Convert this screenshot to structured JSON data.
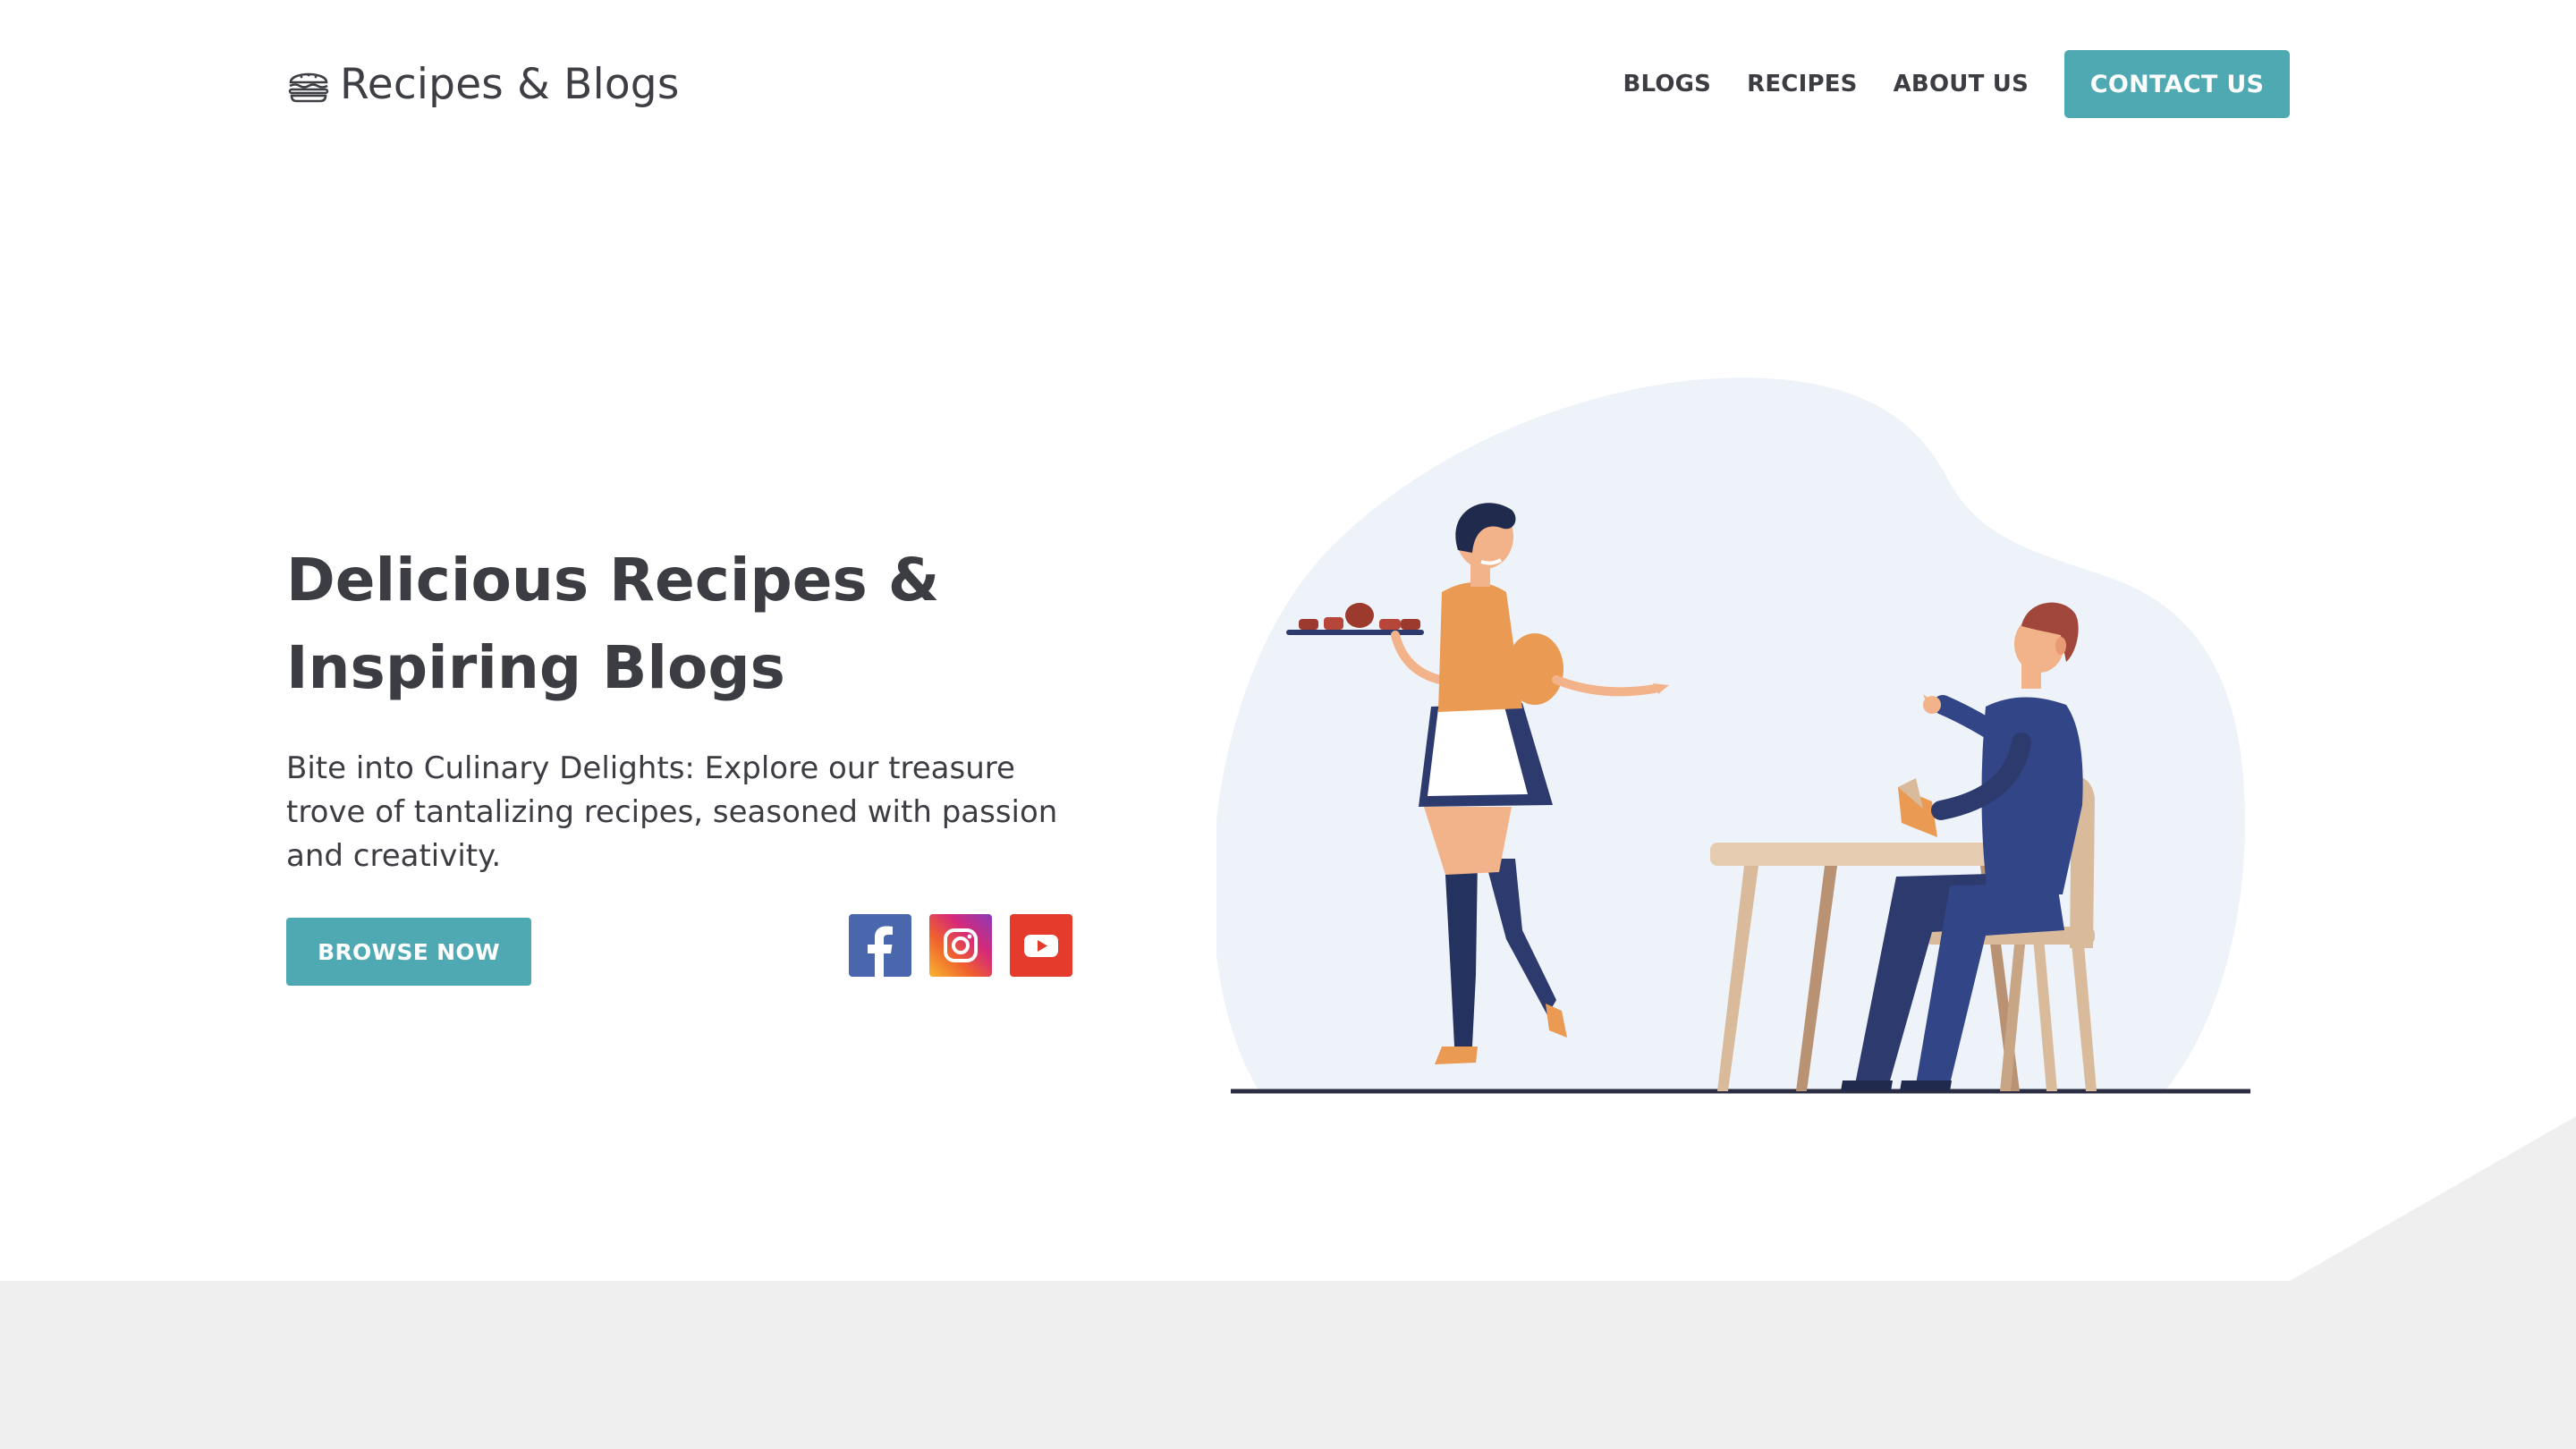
{
  "header": {
    "logo_text": "Recipes & Blogs",
    "logo_icon": "burger-icon",
    "nav": [
      {
        "label": "BLOGS"
      },
      {
        "label": "RECIPES"
      },
      {
        "label": "ABOUT US"
      }
    ],
    "contact_label": "CONTACT US"
  },
  "hero": {
    "title_line1": "Delicious Recipes &",
    "title_line2": "Inspiring Blogs",
    "description": "Bite into Culinary Delights: Explore our treasure trove of tantalizing recipes, seasoned with passion and creativity.",
    "browse_label": "BROWSE NOW",
    "social": [
      {
        "icon": "facebook-icon",
        "color": "#4a67ad"
      },
      {
        "icon": "instagram-icon",
        "color": "#d62a78"
      },
      {
        "icon": "youtube-icon",
        "color": "#e53b2c"
      }
    ]
  },
  "colors": {
    "accent": "#4fa9b3",
    "text": "#3b3d42",
    "illustration_bg": "#edf3f9",
    "band": "#efefef"
  }
}
